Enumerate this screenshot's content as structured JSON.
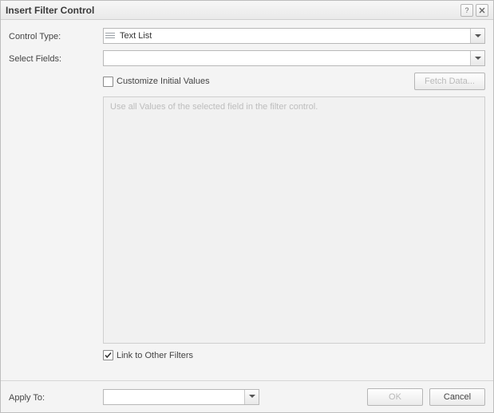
{
  "titlebar": {
    "title": "Insert Filter Control"
  },
  "labels": {
    "control_type": "Control Type:",
    "select_fields": "Select Fields:",
    "apply_to": "Apply To:"
  },
  "control_type": {
    "value": "Text List"
  },
  "select_fields": {
    "value": ""
  },
  "customize_initial_values": {
    "checked": false,
    "label": "Customize Initial Values"
  },
  "fetch_data_button": {
    "label": "Fetch Data...",
    "enabled": false
  },
  "values_placeholder": "Use all Values of the selected field in the filter control.",
  "link_to_other_filters": {
    "checked": true,
    "label": "Link to Other Filters"
  },
  "apply_to": {
    "value": ""
  },
  "buttons": {
    "ok": "OK",
    "cancel": "Cancel"
  },
  "ok_enabled": false
}
